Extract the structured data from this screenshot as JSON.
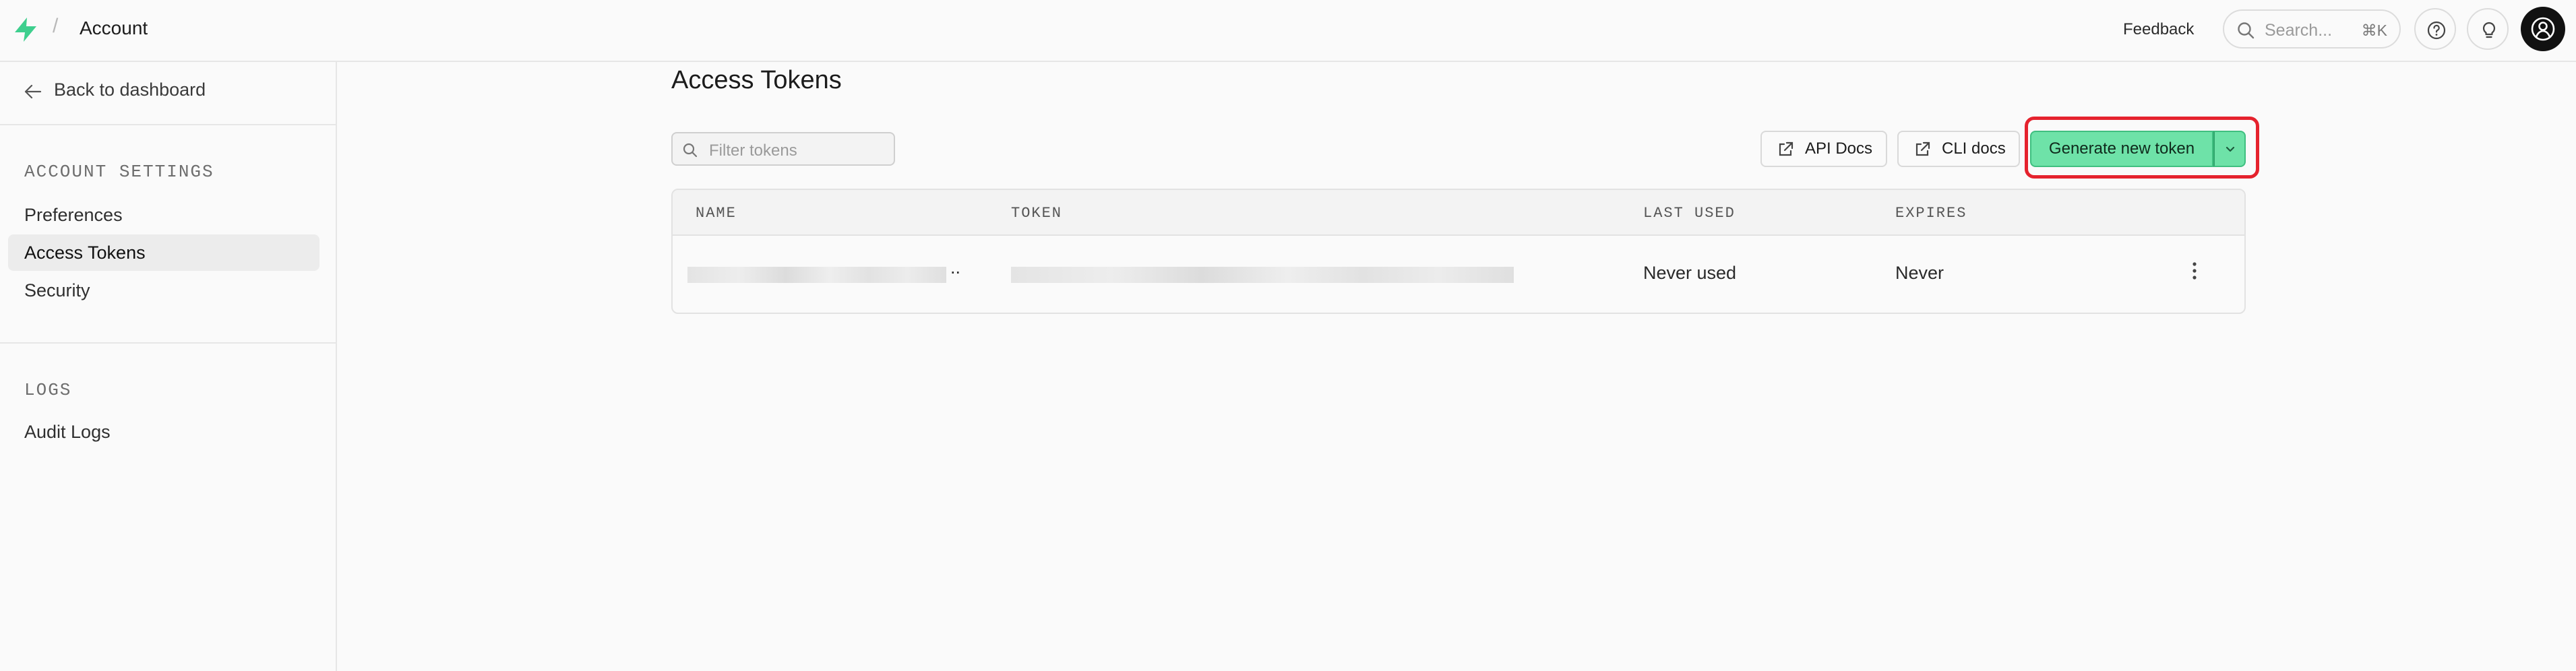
{
  "header": {
    "breadcrumb_separator": "/",
    "title": "Account",
    "feedback_label": "Feedback",
    "search_placeholder": "Search...",
    "search_shortcut": "⌘K",
    "brand_color": "#3ecf8e"
  },
  "sidebar": {
    "back_label": "Back to dashboard",
    "sections": [
      {
        "title": "ACCOUNT SETTINGS",
        "items": [
          {
            "label": "Preferences",
            "active": false
          },
          {
            "label": "Access Tokens",
            "active": true
          },
          {
            "label": "Security",
            "active": false
          }
        ]
      },
      {
        "title": "LOGS",
        "items": [
          {
            "label": "Audit Logs",
            "active": false
          }
        ]
      }
    ]
  },
  "main": {
    "title": "Access Tokens",
    "filter_placeholder": "Filter tokens",
    "api_docs_label": "API Docs",
    "cli_docs_label": "CLI docs",
    "generate_label": "Generate new token",
    "accent_color": "#6ee2a8",
    "highlight_color": "#e5222d",
    "table": {
      "columns": [
        "NAME",
        "TOKEN",
        "LAST USED",
        "EXPIRES"
      ],
      "rows": [
        {
          "name_suffix": "..",
          "last_used": "Never used",
          "expires": "Never"
        }
      ]
    }
  }
}
